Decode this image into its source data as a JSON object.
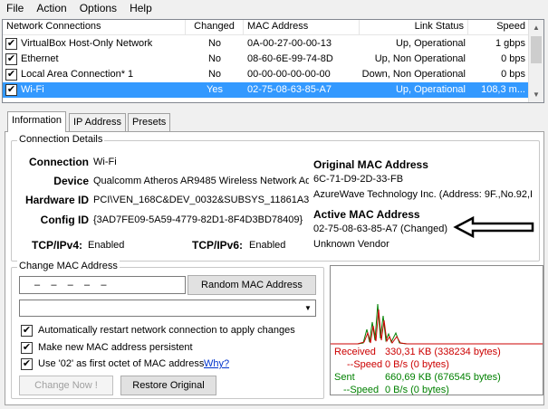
{
  "menu": [
    "File",
    "Action",
    "Options",
    "Help"
  ],
  "list": {
    "columns": [
      "Network Connections",
      "Changed",
      "MAC Address",
      "Link Status",
      "Speed"
    ],
    "rows": [
      {
        "name": "VirtualBox Host-Only Network",
        "changed": "No",
        "mac": "0A-00-27-00-00-13",
        "status": "Up, Operational",
        "speed": "1 gbps",
        "selected": false
      },
      {
        "name": "Ethernet",
        "changed": "No",
        "mac": "08-60-6E-99-74-8D",
        "status": "Up, Non Operational",
        "speed": "0 bps",
        "selected": false
      },
      {
        "name": "Local Area Connection* 1",
        "changed": "No",
        "mac": "00-00-00-00-00-00",
        "status": "Down, Non Operational",
        "speed": "0 bps",
        "selected": false
      },
      {
        "name": "Wi-Fi",
        "changed": "Yes",
        "mac": "02-75-08-63-85-A7",
        "status": "Up, Operational",
        "speed": "108,3 m...",
        "selected": true
      }
    ]
  },
  "tabs": [
    "Information",
    "IP Address",
    "Presets"
  ],
  "details": {
    "group_title": "Connection Details",
    "connection_label": "Connection",
    "connection_value": "Wi-Fi",
    "device_label": "Device",
    "device_value": "Qualcomm Atheros AR9485 Wireless Network Ad",
    "hardware_label": "Hardware ID",
    "hardware_value": "PCI\\VEN_168C&DEV_0032&SUBSYS_11861A3I",
    "config_label": "Config ID",
    "config_value": "{3AD7FE09-5A59-4779-82D1-8F4D3BD78409}",
    "tcp4_label": "TCP/IPv4:",
    "tcp4_value": "Enabled",
    "tcp6_label": "TCP/IPv6:",
    "tcp6_value": "Enabled",
    "orig_mac_title": "Original MAC Address",
    "orig_mac": "6C-71-D9-2D-33-FB",
    "orig_vendor": "AzureWave Technology Inc.  (Address: 9F.,No.92,I",
    "active_mac_title": "Active MAC Address",
    "active_mac": "02-75-08-63-85-A7 (Changed)",
    "active_vendor": "Unknown Vendor"
  },
  "change": {
    "group_title": "Change MAC Address",
    "mac_placeholder": "–    –    –    –    –",
    "random_button": "Random MAC Address",
    "opt_restart": "Automatically restart network connection to apply changes",
    "opt_persistent": "Make new MAC address persistent",
    "opt_02": "Use '02' as first octet of MAC address",
    "why_link": "Why?",
    "change_button": "Change Now !",
    "restore_button": "Restore Original"
  },
  "stats": {
    "received_label": "Received",
    "received_value": "330,31 KB (338234 bytes)",
    "rspeed_label": "--Speed",
    "rspeed_value": "0 B/s (0 bytes)",
    "sent_label": "Sent",
    "sent_value": "660,69 KB (676545 bytes)",
    "sspeed_label": "--Speed",
    "sspeed_value": "0 B/s (0 bytes)"
  },
  "colors": {
    "received": "#cc0000",
    "sent": "#008000",
    "selection": "#3399ff"
  },
  "icons": {
    "checked": "✔",
    "scroll_up": "▲",
    "scroll_down": "▼",
    "dropdown": "▼"
  }
}
